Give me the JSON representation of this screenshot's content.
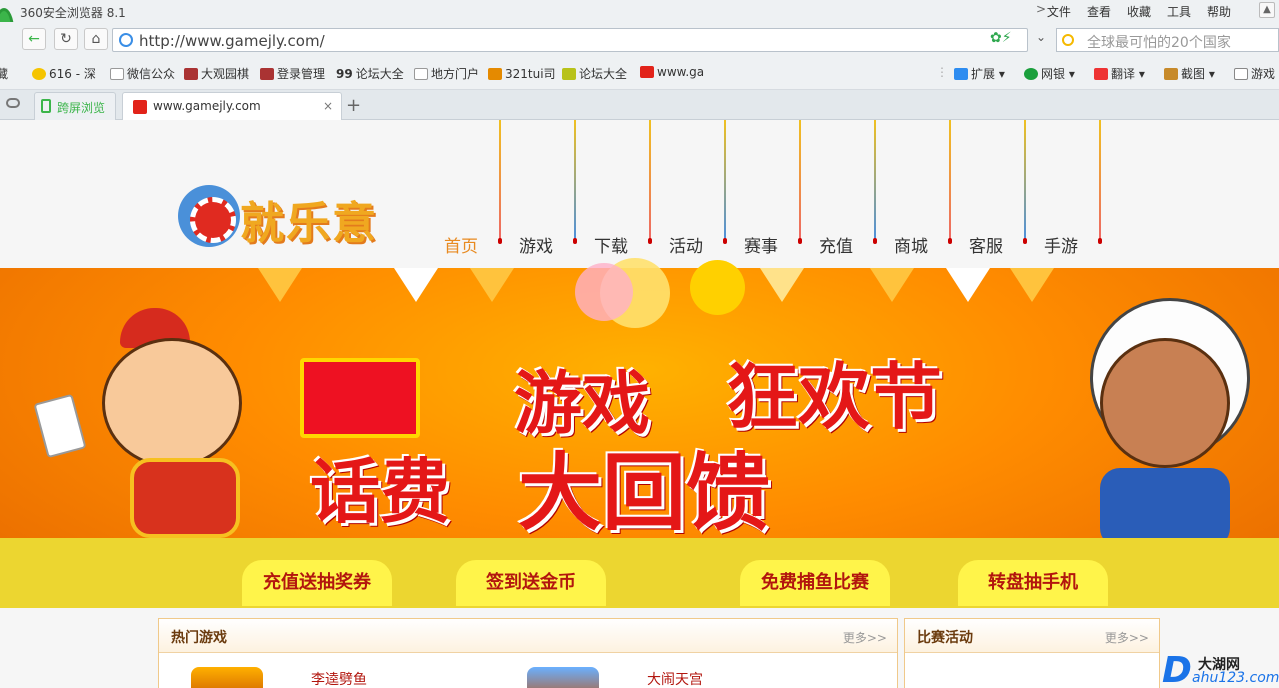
{
  "browser": {
    "title": "360安全浏览器 8.1",
    "menus": [
      "文件",
      "查看",
      "收藏",
      "工具",
      "帮助"
    ],
    "url": "http://www.gamejly.com/",
    "search_placeholder": "全球最可怕的20个国家"
  },
  "bookmarks": {
    "left": [
      "藏",
      "616 - 深",
      "微信公众",
      "大观园棋",
      "登录管理",
      "论坛大全",
      "地方门户",
      "321tui司",
      "论坛大全",
      "www.ga"
    ],
    "right": [
      "扩展",
      "网银",
      "翻译",
      "截图",
      "游戏"
    ]
  },
  "tabs": {
    "tab1": "跨屏浏览",
    "tab2": "www.gamejly.com",
    "new_tab": "+"
  },
  "site": {
    "logo_text": "就乐意",
    "nav": [
      "首页",
      "游戏",
      "下载",
      "活动",
      "赛事",
      "充值",
      "商城",
      "客服",
      "手游"
    ],
    "banner": {
      "line1a": "游戏",
      "line1b": "狂欢节",
      "line2a": "话费",
      "line2b": "大回馈",
      "pills": [
        "充值送抽奖券",
        "签到送金币",
        "免费捕鱼比赛",
        "转盘抽手机"
      ]
    },
    "panels": {
      "hot_title": "热门游戏",
      "hot_more": "更多>>",
      "games": [
        "李逵劈鱼",
        "大闹天宫"
      ],
      "match_title": "比赛活动",
      "match_more": "更多>>"
    },
    "watermark": {
      "letter": "D",
      "name": "大湖网",
      "url": "ahu123.com"
    }
  }
}
